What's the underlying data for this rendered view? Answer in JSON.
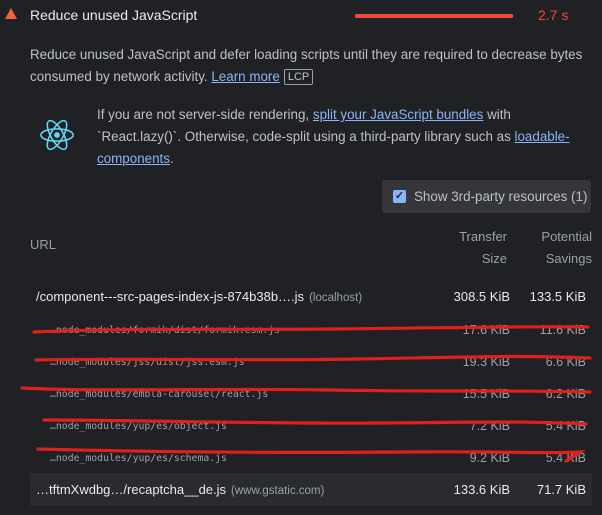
{
  "audit": {
    "title": "Reduce unused JavaScript",
    "value": "2.7 s",
    "description_text": "Reduce unused JavaScript and defer loading scripts until they are required to decrease bytes consumed by network activity.",
    "learn_more": "Learn more",
    "badge": "LCP"
  },
  "stack_pack": {
    "icon": "react-icon",
    "text_1": "If you are not server-side rendering,",
    "link_1": "split your JavaScript bundles",
    "text_2": "with `React.lazy()`. Otherwise, code-split using a third-party library such as",
    "link_2": "loadable-components",
    "text_3": "."
  },
  "third_party": {
    "label": "Show 3rd-party resources (1)",
    "checked": true
  },
  "table": {
    "headers": {
      "url": "URL",
      "transfer_line1": "Transfer",
      "transfer_line2": "Size",
      "savings_line1": "Potential",
      "savings_line2": "Savings"
    },
    "rows": [
      {
        "url": "/component---src-pages-index-js-874b38b….js",
        "host": "(localhost)",
        "transfer": "308.5 KiB",
        "savings": "133.5 KiB"
      },
      {
        "url": "…node_modules/formik/dist/formik.esm.js",
        "transfer": "17.6 KiB",
        "savings": "11.6 KiB"
      },
      {
        "url": "…node_modules/jss/dist/jss.esm.js",
        "transfer": "19.3 KiB",
        "savings": "6.6 KiB"
      },
      {
        "url": "…node_modules/embla-carousel/react.js",
        "transfer": "15.5 KiB",
        "savings": "6.2 KiB"
      },
      {
        "url": "…node_modules/yup/es/object.js",
        "transfer": "7.2 KiB",
        "savings": "5.4 KiB"
      },
      {
        "url": "…node_modules/yup/es/schema.js",
        "transfer": "9.2 KiB",
        "savings": "5.4 KiB"
      },
      {
        "url": "…tftmXwdbg…/recaptcha__de.js",
        "host": "(www.gstatic.com)",
        "transfer": "133.6 KiB",
        "savings": "71.7 KiB"
      }
    ]
  },
  "colors": {
    "accent_red": "#f5483c",
    "link": "#8ab4f8",
    "background": "#202124"
  }
}
